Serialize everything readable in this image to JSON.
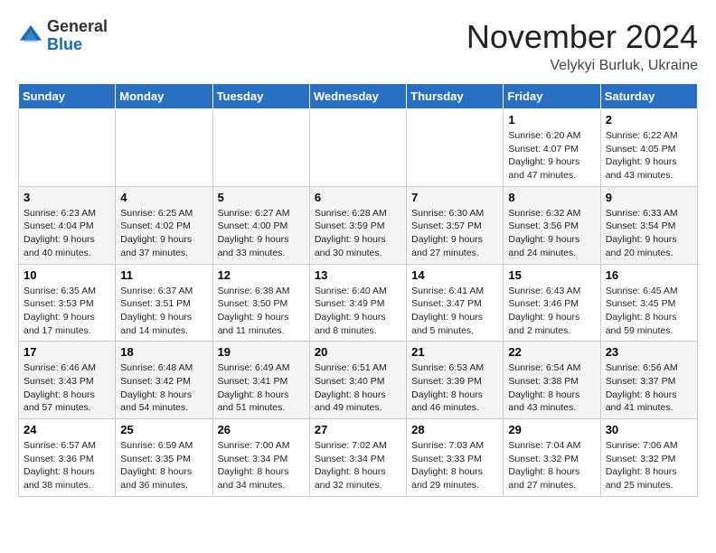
{
  "header": {
    "logo_general": "General",
    "logo_blue": "Blue",
    "month_title": "November 2024",
    "subtitle": "Velykyi Burluk, Ukraine"
  },
  "weekdays": [
    "Sunday",
    "Monday",
    "Tuesday",
    "Wednesday",
    "Thursday",
    "Friday",
    "Saturday"
  ],
  "weeks": [
    [
      null,
      null,
      null,
      null,
      null,
      {
        "day": "1",
        "sunrise": "Sunrise: 6:20 AM",
        "sunset": "Sunset: 4:07 PM",
        "daylight": "Daylight: 9 hours and 47 minutes."
      },
      {
        "day": "2",
        "sunrise": "Sunrise: 6:22 AM",
        "sunset": "Sunset: 4:05 PM",
        "daylight": "Daylight: 9 hours and 43 minutes."
      }
    ],
    [
      {
        "day": "3",
        "sunrise": "Sunrise: 6:23 AM",
        "sunset": "Sunset: 4:04 PM",
        "daylight": "Daylight: 9 hours and 40 minutes."
      },
      {
        "day": "4",
        "sunrise": "Sunrise: 6:25 AM",
        "sunset": "Sunset: 4:02 PM",
        "daylight": "Daylight: 9 hours and 37 minutes."
      },
      {
        "day": "5",
        "sunrise": "Sunrise: 6:27 AM",
        "sunset": "Sunset: 4:00 PM",
        "daylight": "Daylight: 9 hours and 33 minutes."
      },
      {
        "day": "6",
        "sunrise": "Sunrise: 6:28 AM",
        "sunset": "Sunset: 3:59 PM",
        "daylight": "Daylight: 9 hours and 30 minutes."
      },
      {
        "day": "7",
        "sunrise": "Sunrise: 6:30 AM",
        "sunset": "Sunset: 3:57 PM",
        "daylight": "Daylight: 9 hours and 27 minutes."
      },
      {
        "day": "8",
        "sunrise": "Sunrise: 6:32 AM",
        "sunset": "Sunset: 3:56 PM",
        "daylight": "Daylight: 9 hours and 24 minutes."
      },
      {
        "day": "9",
        "sunrise": "Sunrise: 6:33 AM",
        "sunset": "Sunset: 3:54 PM",
        "daylight": "Daylight: 9 hours and 20 minutes."
      }
    ],
    [
      {
        "day": "10",
        "sunrise": "Sunrise: 6:35 AM",
        "sunset": "Sunset: 3:53 PM",
        "daylight": "Daylight: 9 hours and 17 minutes."
      },
      {
        "day": "11",
        "sunrise": "Sunrise: 6:37 AM",
        "sunset": "Sunset: 3:51 PM",
        "daylight": "Daylight: 9 hours and 14 minutes."
      },
      {
        "day": "12",
        "sunrise": "Sunrise: 6:38 AM",
        "sunset": "Sunset: 3:50 PM",
        "daylight": "Daylight: 9 hours and 11 minutes."
      },
      {
        "day": "13",
        "sunrise": "Sunrise: 6:40 AM",
        "sunset": "Sunset: 3:49 PM",
        "daylight": "Daylight: 9 hours and 8 minutes."
      },
      {
        "day": "14",
        "sunrise": "Sunrise: 6:41 AM",
        "sunset": "Sunset: 3:47 PM",
        "daylight": "Daylight: 9 hours and 5 minutes."
      },
      {
        "day": "15",
        "sunrise": "Sunrise: 6:43 AM",
        "sunset": "Sunset: 3:46 PM",
        "daylight": "Daylight: 9 hours and 2 minutes."
      },
      {
        "day": "16",
        "sunrise": "Sunrise: 6:45 AM",
        "sunset": "Sunset: 3:45 PM",
        "daylight": "Daylight: 8 hours and 59 minutes."
      }
    ],
    [
      {
        "day": "17",
        "sunrise": "Sunrise: 6:46 AM",
        "sunset": "Sunset: 3:43 PM",
        "daylight": "Daylight: 8 hours and 57 minutes."
      },
      {
        "day": "18",
        "sunrise": "Sunrise: 6:48 AM",
        "sunset": "Sunset: 3:42 PM",
        "daylight": "Daylight: 8 hours and 54 minutes."
      },
      {
        "day": "19",
        "sunrise": "Sunrise: 6:49 AM",
        "sunset": "Sunset: 3:41 PM",
        "daylight": "Daylight: 8 hours and 51 minutes."
      },
      {
        "day": "20",
        "sunrise": "Sunrise: 6:51 AM",
        "sunset": "Sunset: 3:40 PM",
        "daylight": "Daylight: 8 hours and 49 minutes."
      },
      {
        "day": "21",
        "sunrise": "Sunrise: 6:53 AM",
        "sunset": "Sunset: 3:39 PM",
        "daylight": "Daylight: 8 hours and 46 minutes."
      },
      {
        "day": "22",
        "sunrise": "Sunrise: 6:54 AM",
        "sunset": "Sunset: 3:38 PM",
        "daylight": "Daylight: 8 hours and 43 minutes."
      },
      {
        "day": "23",
        "sunrise": "Sunrise: 6:56 AM",
        "sunset": "Sunset: 3:37 PM",
        "daylight": "Daylight: 8 hours and 41 minutes."
      }
    ],
    [
      {
        "day": "24",
        "sunrise": "Sunrise: 6:57 AM",
        "sunset": "Sunset: 3:36 PM",
        "daylight": "Daylight: 8 hours and 38 minutes."
      },
      {
        "day": "25",
        "sunrise": "Sunrise: 6:59 AM",
        "sunset": "Sunset: 3:35 PM",
        "daylight": "Daylight: 8 hours and 36 minutes."
      },
      {
        "day": "26",
        "sunrise": "Sunrise: 7:00 AM",
        "sunset": "Sunset: 3:34 PM",
        "daylight": "Daylight: 8 hours and 34 minutes."
      },
      {
        "day": "27",
        "sunrise": "Sunrise: 7:02 AM",
        "sunset": "Sunset: 3:34 PM",
        "daylight": "Daylight: 8 hours and 32 minutes."
      },
      {
        "day": "28",
        "sunrise": "Sunrise: 7:03 AM",
        "sunset": "Sunset: 3:33 PM",
        "daylight": "Daylight: 8 hours and 29 minutes."
      },
      {
        "day": "29",
        "sunrise": "Sunrise: 7:04 AM",
        "sunset": "Sunset: 3:32 PM",
        "daylight": "Daylight: 8 hours and 27 minutes."
      },
      {
        "day": "30",
        "sunrise": "Sunrise: 7:06 AM",
        "sunset": "Sunset: 3:32 PM",
        "daylight": "Daylight: 8 hours and 25 minutes."
      }
    ]
  ]
}
